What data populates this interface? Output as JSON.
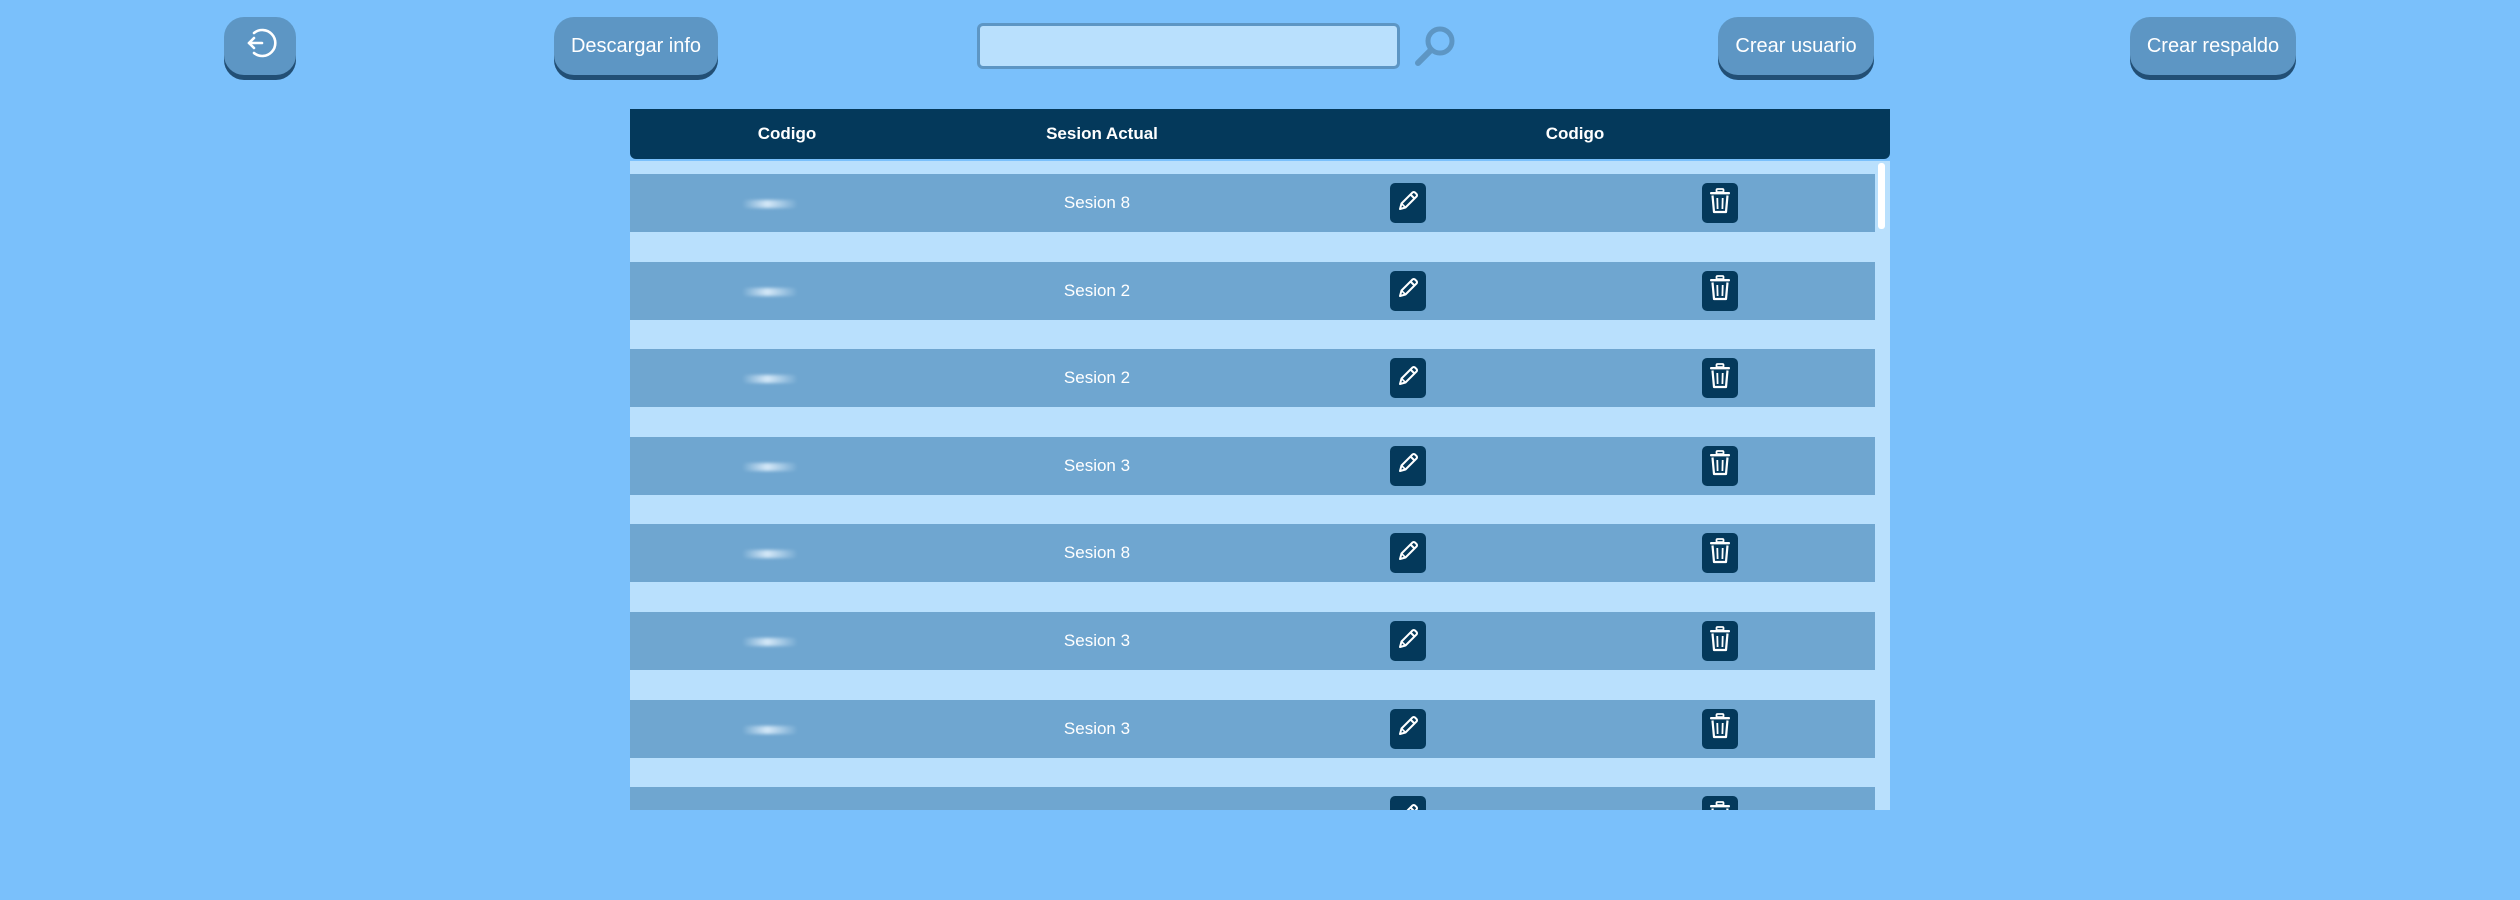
{
  "toolbar": {
    "download_label": "Descargar info",
    "create_user_label": "Crear usuario",
    "backup_label": "Crear respaldo",
    "search_value": "",
    "search_placeholder": ""
  },
  "table": {
    "headers": [
      "Codigo",
      "Sesion Actual",
      "Codigo"
    ],
    "rows": [
      {
        "session": "Sesion 8"
      },
      {
        "session": "Sesion 2"
      },
      {
        "session": "Sesion 2"
      },
      {
        "session": "Sesion 3"
      },
      {
        "session": "Sesion 8"
      },
      {
        "session": "Sesion 3"
      },
      {
        "session": "Sesion 3"
      },
      {
        "session": ""
      }
    ]
  },
  "icons": {
    "logout": "logout-icon",
    "search": "search-icon",
    "edit": "pencil-icon",
    "delete": "trash-icon"
  },
  "colors": {
    "background": "#7ac0fb",
    "button": "#5d96c4",
    "header": "#04395b",
    "row": "#6fa6d0",
    "row_gap": "#b9e0fd"
  }
}
